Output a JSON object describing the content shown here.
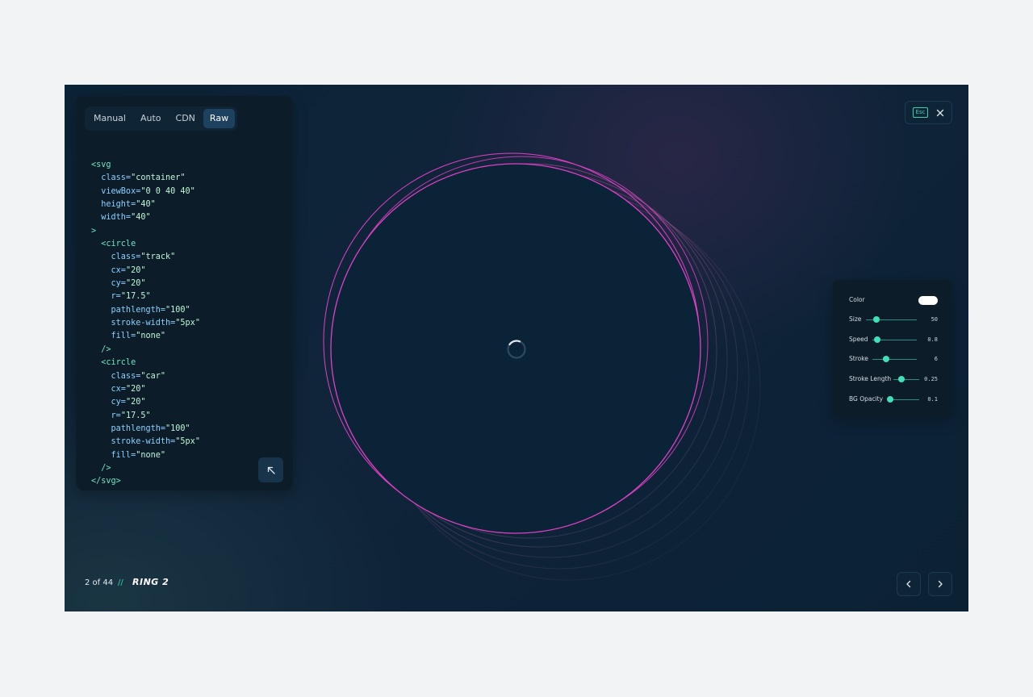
{
  "tabs": [
    {
      "label": "Manual",
      "active": false
    },
    {
      "label": "Auto",
      "active": false
    },
    {
      "label": "CDN",
      "active": false
    },
    {
      "label": "Raw",
      "active": true
    }
  ],
  "code_lines": [
    [
      [
        "tag",
        "<svg"
      ]
    ],
    [
      [
        "attr",
        "  class="
      ],
      [
        "val",
        "\"container\""
      ]
    ],
    [
      [
        "attr",
        "  viewBox="
      ],
      [
        "val",
        "\"0 0 40 40\""
      ]
    ],
    [
      [
        "attr",
        "  height="
      ],
      [
        "val",
        "\"40\""
      ]
    ],
    [
      [
        "attr",
        "  width="
      ],
      [
        "val",
        "\"40\""
      ]
    ],
    [
      [
        "tag",
        ">"
      ]
    ],
    [
      [
        "tag",
        "  <circle"
      ]
    ],
    [
      [
        "attr",
        "    class="
      ],
      [
        "val",
        "\"track\""
      ]
    ],
    [
      [
        "attr",
        "    cx="
      ],
      [
        "val",
        "\"20\""
      ]
    ],
    [
      [
        "attr",
        "    cy="
      ],
      [
        "val",
        "\"20\""
      ]
    ],
    [
      [
        "attr",
        "    r="
      ],
      [
        "val",
        "\"17.5\""
      ]
    ],
    [
      [
        "attr",
        "    pathlength="
      ],
      [
        "val",
        "\"100\""
      ]
    ],
    [
      [
        "attr",
        "    stroke-width="
      ],
      [
        "val",
        "\"5px\""
      ]
    ],
    [
      [
        "attr",
        "    fill="
      ],
      [
        "val",
        "\"none\""
      ]
    ],
    [
      [
        "tag",
        "  />"
      ]
    ],
    [
      [
        "tag",
        "  <circle"
      ]
    ],
    [
      [
        "attr",
        "    class="
      ],
      [
        "val",
        "\"car\""
      ]
    ],
    [
      [
        "attr",
        "    cx="
      ],
      [
        "val",
        "\"20\""
      ]
    ],
    [
      [
        "attr",
        "    cy="
      ],
      [
        "val",
        "\"20\""
      ]
    ],
    [
      [
        "attr",
        "    r="
      ],
      [
        "val",
        "\"17.5\""
      ]
    ],
    [
      [
        "attr",
        "    pathlength="
      ],
      [
        "val",
        "\"100\""
      ]
    ],
    [
      [
        "attr",
        "    stroke-width="
      ],
      [
        "val",
        "\"5px\""
      ]
    ],
    [
      [
        "attr",
        "    fill="
      ],
      [
        "val",
        "\"none\""
      ]
    ],
    [
      [
        "tag",
        "  />"
      ]
    ],
    [
      [
        "tag",
        "</svg>"
      ]
    ]
  ],
  "esc": {
    "key_label": "Esc"
  },
  "controls": {
    "color": {
      "label": "Color",
      "value": "#ffffff"
    },
    "size": {
      "label": "Size",
      "value": "50",
      "fraction": 0.2
    },
    "speed": {
      "label": "Speed",
      "value": "0.8",
      "fraction": 0.1
    },
    "stroke": {
      "label": "Stroke",
      "value": "6",
      "fraction": 0.3
    },
    "stroke_length": {
      "label": "Stroke Length",
      "value": "0.25",
      "fraction": 0.3
    },
    "bg_opacity": {
      "label": "BG Opacity",
      "value": "0.1",
      "fraction": 0.1
    }
  },
  "footer": {
    "counter": "2 of 44",
    "separator": "//",
    "title": "RING 2"
  },
  "colors": {
    "accent": "#3fe0b8",
    "ring": "#e040c8",
    "panel": "#0c1c28",
    "stage": "#0b2336"
  },
  "icons": {
    "close": "close-icon",
    "expand": "arrow-up-left-icon",
    "prev": "chevron-left-icon",
    "next": "chevron-right-icon"
  }
}
